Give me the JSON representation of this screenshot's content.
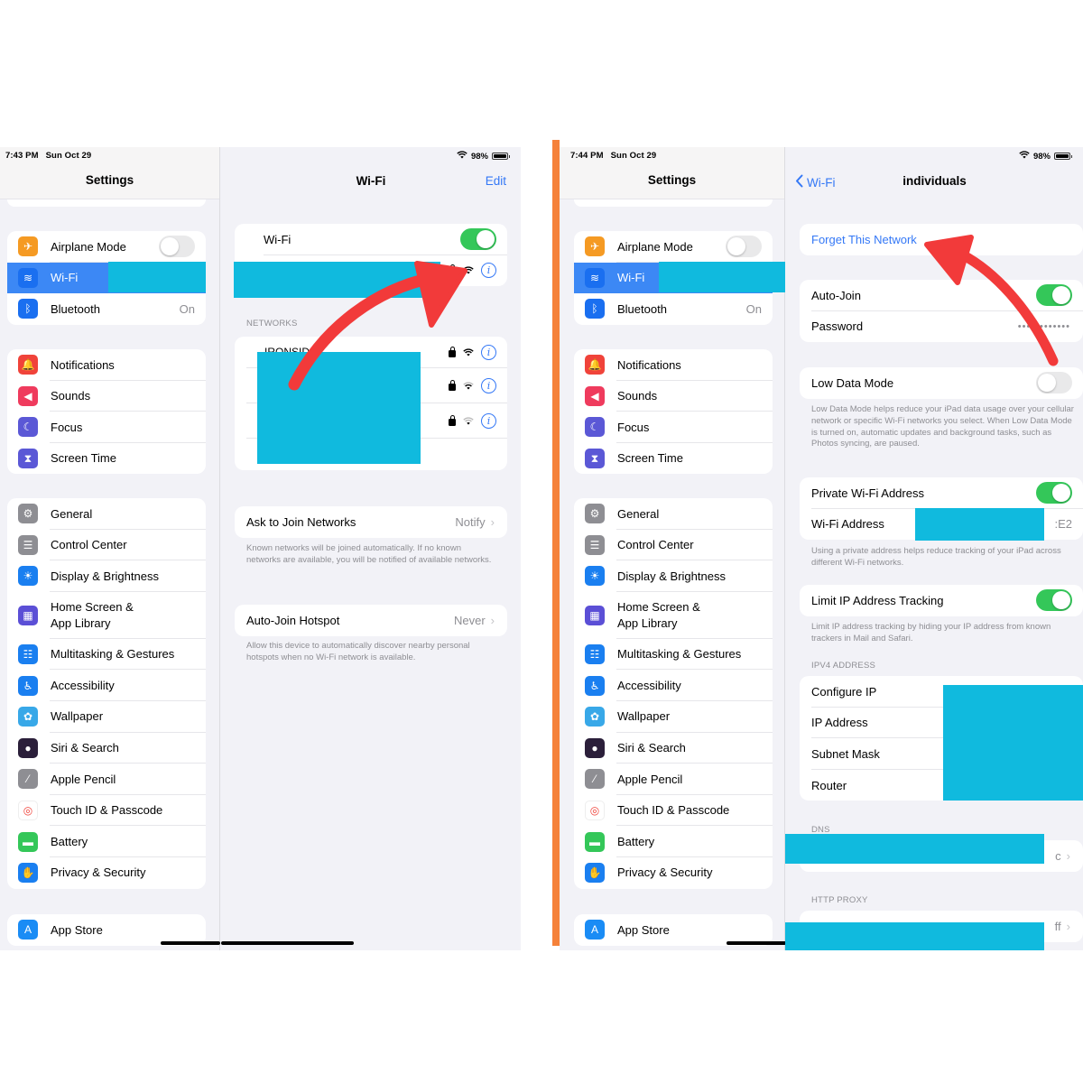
{
  "colors": {
    "accent": "#3478f6",
    "toggle_on": "#34c759",
    "redaction": "#10bade",
    "arrow": "#f23a3a",
    "divider_bar": "#f5813a",
    "selected_row": "#3c88f5"
  },
  "left_screen": {
    "status_bar": {
      "time": "7:43 PM",
      "date": "Sun Oct 29",
      "wifi_icon": "wifi-icon",
      "battery": "98%"
    },
    "sidebar": {
      "title": "Settings",
      "groups": [
        [
          {
            "label": "Airplane Mode",
            "icon": "airplane-icon",
            "color": "#f59a23",
            "toggle": "off"
          },
          {
            "label": "Wi-Fi",
            "icon": "wifi-icon",
            "color": "#1a6ff0",
            "selected": true
          },
          {
            "label": "Bluetooth",
            "icon": "bluetooth-icon",
            "color": "#1a6ff0",
            "value": "On"
          }
        ],
        [
          {
            "label": "Notifications",
            "icon": "bell-icon",
            "color": "#f0433a"
          },
          {
            "label": "Sounds",
            "icon": "speaker-icon",
            "color": "#ef3b5d"
          },
          {
            "label": "Focus",
            "icon": "moon-icon",
            "color": "#5b58d6"
          },
          {
            "label": "Screen Time",
            "icon": "hourglass-icon",
            "color": "#5b58d6"
          }
        ],
        [
          {
            "label": "General",
            "icon": "gear-icon",
            "color": "#8e8e93"
          },
          {
            "label": "Control Center",
            "icon": "switches-icon",
            "color": "#8e8e93"
          },
          {
            "label": "Display & Brightness",
            "icon": "sun-icon",
            "color": "#1a7ff0"
          },
          {
            "label": "Home Screen & App Library",
            "icon": "grid-icon",
            "color": "#5b4fd6",
            "tall": true
          },
          {
            "label": "Multitasking & Gestures",
            "icon": "multitask-icon",
            "color": "#1a7ff0"
          },
          {
            "label": "Accessibility",
            "icon": "accessibility-icon",
            "color": "#1a7ff0"
          },
          {
            "label": "Wallpaper",
            "icon": "flower-icon",
            "color": "#38a8e8"
          },
          {
            "label": "Siri & Search",
            "icon": "siri-icon",
            "color": "#2b1f3a"
          },
          {
            "label": "Apple Pencil",
            "icon": "pencil-icon",
            "color": "#8e8e93"
          },
          {
            "label": "Touch ID & Passcode",
            "icon": "fingerprint-icon",
            "color": "#ffffff"
          },
          {
            "label": "Battery",
            "icon": "battery-icon",
            "color": "#34c759"
          },
          {
            "label": "Privacy & Security",
            "icon": "hand-icon",
            "color": "#1a7ff0"
          }
        ],
        [
          {
            "label": "App Store",
            "icon": "app-store-icon",
            "color": "#1a8cf5"
          }
        ]
      ]
    },
    "wifi_panel": {
      "title": "Wi-Fi",
      "edit_label": "Edit",
      "wifi_toggle_label": "Wi-Fi",
      "wifi_toggle": "on",
      "networks_header": "NETWORKS",
      "networks_partial_name": "IRONSID",
      "network_count": 3,
      "ask_to_join_label": "Ask to Join Networks",
      "ask_to_join_value": "Notify",
      "ask_to_join_footer": "Known networks will be joined automatically. If no known networks are available, you will be notified of available networks.",
      "auto_join_hotspot_label": "Auto-Join Hotspot",
      "auto_join_hotspot_value": "Never",
      "auto_join_hotspot_footer": "Allow this device to automatically discover nearby personal hotspots when no Wi-Fi network is available."
    }
  },
  "right_screen": {
    "status_bar": {
      "time": "7:44 PM",
      "date": "Sun Oct 29",
      "wifi_icon": "wifi-icon",
      "battery": "98%"
    },
    "sidebar_title": "Settings",
    "network_detail": {
      "back_label": "Wi-Fi",
      "title": "individuals",
      "forget_label": "Forget This Network",
      "auto_join_label": "Auto-Join",
      "auto_join": "on",
      "password_label": "Password",
      "password_mask": "••••••••••••",
      "low_data_label": "Low Data Mode",
      "low_data": "off",
      "low_data_footer": "Low Data Mode helps reduce your iPad data usage over your cellular network or specific Wi-Fi networks you select. When Low Data Mode is turned on, automatic updates and background tasks, such as Photos syncing, are paused.",
      "private_address_label": "Private Wi-Fi Address",
      "private_address": "on",
      "wifi_address_label": "Wi-Fi Address",
      "wifi_address_partial": ":E2",
      "private_footer": "Using a private address helps reduce tracking of your iPad across different Wi-Fi networks.",
      "limit_ip_label": "Limit IP Address Tracking",
      "limit_ip": "on",
      "limit_ip_footer": "Limit IP address tracking by hiding your IP address from known trackers in Mail and Safari.",
      "ipv4_header": "IPV4 ADDRESS",
      "ipv4_rows": [
        "Configure IP",
        "IP Address",
        "Subnet Mask",
        "Router"
      ],
      "dns_header": "DNS",
      "dns_partial_value": "c",
      "http_proxy_header": "HTTP PROXY",
      "http_proxy_partial_value": "ff"
    }
  }
}
